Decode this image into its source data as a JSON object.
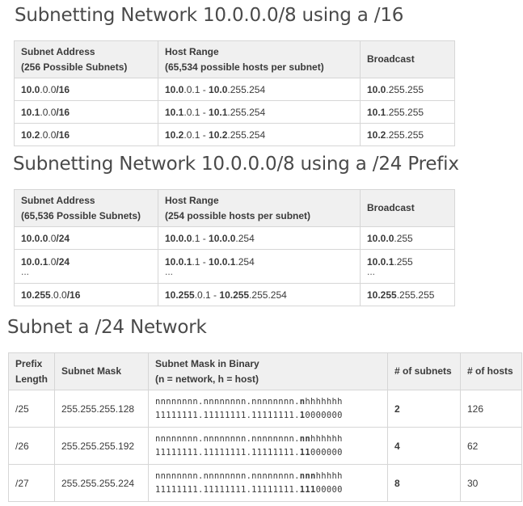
{
  "section1": {
    "heading": "Subnetting Network 10.0.0.0/8 using a /16",
    "headers": {
      "subnet_line1": "Subnet Address",
      "subnet_line2": "(256 Possible Subnets)",
      "host_line1": "Host Range",
      "host_line2": "(65,534 possible hosts per subnet)",
      "broadcast": "Broadcast"
    },
    "rows": [
      {
        "subnet_bold_a": "10.0",
        "subnet_plain": ".0.0",
        "subnet_bold_b": "/16",
        "host_bold_a": "10.0",
        "host_plain_a": ".0.1 - ",
        "host_bold_b": "10.0",
        "host_plain_b": ".255.254",
        "bc_bold": "10.0",
        "bc_plain": ".255.255"
      },
      {
        "subnet_bold_a": "10.1",
        "subnet_plain": ".0.0",
        "subnet_bold_b": "/16",
        "host_bold_a": "10.1",
        "host_plain_a": ".0.1 - ",
        "host_bold_b": "10.1",
        "host_plain_b": ".255.254",
        "bc_bold": "10.1",
        "bc_plain": ".255.255"
      },
      {
        "subnet_bold_a": "10.2",
        "subnet_plain": ".0.0",
        "subnet_bold_b": "/16",
        "host_bold_a": "10.2",
        "host_plain_a": ".0.1 - ",
        "host_bold_b": "10.2",
        "host_plain_b": ".255.254",
        "bc_bold": "10.2",
        "bc_plain": ".255.255"
      }
    ]
  },
  "section2": {
    "heading": "Subnetting Network 10.0.0.0/8 using a /24 Prefix",
    "headers": {
      "subnet_line1": "Subnet Address",
      "subnet_line2": "(65,536 Possible Subnets)",
      "host_line1": "Host Range",
      "host_line2": "(254 possible hosts per subnet)",
      "broadcast": "Broadcast"
    },
    "rows": [
      {
        "subnet_bold_a": "10.0.0",
        "subnet_plain": ".0",
        "subnet_bold_b": "/24",
        "host_bold_a": "10.0.0",
        "host_plain_a": ".1 - ",
        "host_bold_b": "10.0.0",
        "host_plain_b": ".254",
        "bc_bold": "10.0.0",
        "bc_plain": ".255"
      },
      {
        "subnet_bold_a": "10.0.1",
        "subnet_plain": ".0",
        "subnet_bold_b": "/24",
        "host_bold_a": "10.0.1",
        "host_plain_a": ".1 - ",
        "host_bold_b": "10.0.1",
        "host_plain_b": ".254",
        "bc_bold": "10.0.1",
        "bc_plain": ".255",
        "ellipsis": "..."
      },
      {
        "subnet_bold_a": "10.255",
        "subnet_plain": ".0.0",
        "subnet_bold_b": "/16",
        "host_bold_a": "10.255",
        "host_plain_a": ".0.1 - ",
        "host_bold_b": "10.255",
        "host_plain_b": ".255.254",
        "bc_bold": "10.255",
        "bc_plain": ".255.255"
      }
    ]
  },
  "section3": {
    "heading": "Subnet a /24 Network",
    "headers": {
      "prefix_line1": "Prefix",
      "prefix_line2": "Length",
      "mask": "Subnet Mask",
      "binary_line1": "Subnet Mask in Binary",
      "binary_line2": "(n = network, h = host)",
      "subnets": "# of subnets",
      "hosts": "# of hosts"
    },
    "rows": [
      {
        "prefix": "/25",
        "mask": "255.255.255.128",
        "nh_plain": "nnnnnnnn.nnnnnnnn.nnnnnnnn.",
        "nh_bold": "n",
        "nh_rest": "hhhhhhh",
        "bin_plain": "11111111.11111111.11111111.",
        "bin_bold": "1",
        "bin_rest": "0000000",
        "subnets": "2",
        "hosts": "126"
      },
      {
        "prefix": "/26",
        "mask": "255.255.255.192",
        "nh_plain": "nnnnnnnn.nnnnnnnn.nnnnnnnn.",
        "nh_bold": "nn",
        "nh_rest": "hhhhhh",
        "bin_plain": "11111111.11111111.11111111.",
        "bin_bold": "11",
        "bin_rest": "000000",
        "subnets": "4",
        "hosts": "62"
      },
      {
        "prefix": "/27",
        "mask": "255.255.255.224",
        "nh_plain": "nnnnnnnn.nnnnnnnn.nnnnnnnn.",
        "nh_bold": "nnn",
        "nh_rest": "hhhhh",
        "bin_plain": "11111111.11111111.11111111.",
        "bin_bold": "111",
        "bin_rest": "00000",
        "subnets": "8",
        "hosts": "30"
      }
    ]
  }
}
